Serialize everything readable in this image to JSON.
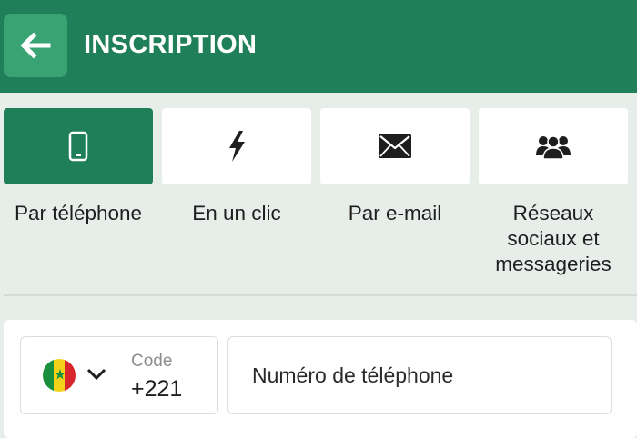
{
  "header": {
    "title": "INSCRIPTION",
    "back_icon": "arrow-left-icon"
  },
  "methods": [
    {
      "label": "Par téléphone",
      "icon": "mobile-phone-icon",
      "active": true
    },
    {
      "label": "En un clic",
      "icon": "lightning-bolt-icon",
      "active": false
    },
    {
      "label": "Par e-mail",
      "icon": "envelope-icon",
      "active": false
    },
    {
      "label": "Réseaux sociaux et messageries",
      "icon": "users-group-icon",
      "active": false
    }
  ],
  "form": {
    "country": {
      "flag": "senegal-flag",
      "code_label": "Code",
      "code_value": "+221"
    },
    "phone": {
      "placeholder": "Numéro de téléphone",
      "value": ""
    }
  },
  "colors": {
    "primary": "#1f7f58",
    "back_button": "#3aa373",
    "background": "#e7eeea"
  }
}
